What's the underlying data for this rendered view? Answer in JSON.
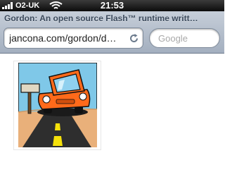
{
  "status_bar": {
    "carrier": "O2-UK",
    "time": "21:53",
    "signal_icon": "signal-bars-icon",
    "wifi_icon": "wifi-icon"
  },
  "browser": {
    "page_title": "Gordon: An open source Flash™ runtime writt…",
    "url": "jancona.com/gordon/d…",
    "reload_icon": "reload-icon",
    "search_placeholder": "Google"
  },
  "content": {
    "image": "flash-animation-cartoon-car"
  },
  "colors": {
    "status_bar": "#0c0c0c",
    "toolbar": "#a3afbf",
    "title_text": "#3c4a5c",
    "car_orange": "#ff6a1a",
    "sky_blue": "#7fc8e8"
  }
}
